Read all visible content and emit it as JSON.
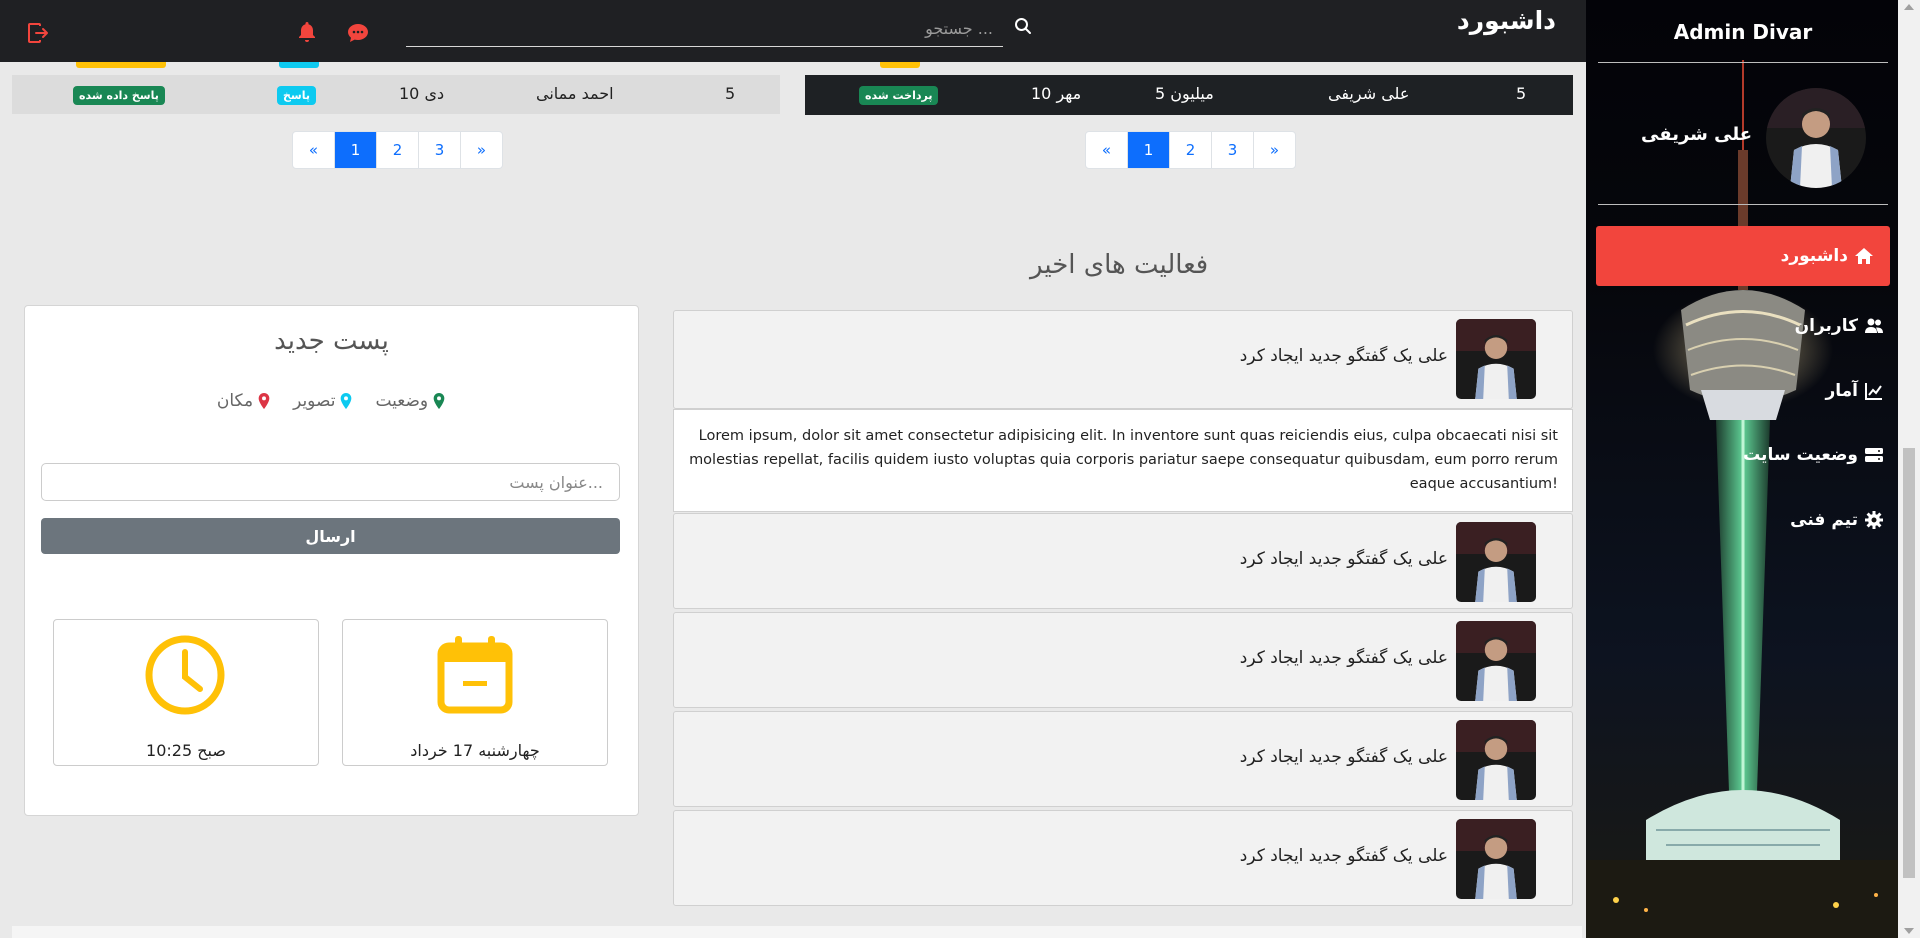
{
  "header": {
    "title": "داشبورد",
    "search_placeholder": "جستجو ..."
  },
  "sidebar": {
    "brand": "Admin Divar",
    "profile_name": "علی شریفی",
    "nav": [
      {
        "label": "داشبورد",
        "icon": "home-icon",
        "active": true
      },
      {
        "label": "کاربران",
        "icon": "users-icon"
      },
      {
        "label": "آمار",
        "icon": "chart-icon"
      },
      {
        "label": "وضعیت سایت",
        "icon": "server-icon"
      },
      {
        "label": "تیم فنی",
        "icon": "gear-icon"
      }
    ]
  },
  "left_table_row": {
    "num": "5",
    "name": "احمد ممانی",
    "date": "10 دی",
    "badge_answer": "پاسخ",
    "badge_status": "پاسخ داده شده"
  },
  "right_table_row": {
    "num": "5",
    "name": "علی شریفی",
    "amount": "5 میلیون",
    "date": "10 مهر",
    "badge_status": "پرداخت شده"
  },
  "pagination": {
    "prev": "«",
    "next": "»",
    "pages": [
      "1",
      "2",
      "3"
    ]
  },
  "activities": {
    "heading": "فعالیت های اخیر",
    "item_text": "علی یک گفتگو جدید ایجاد کرد",
    "lorem": "Lorem ipsum, dolor sit amet consectetur adipisicing elit. In inventore sunt quas reiciendis eius, culpa obcaecati nisi sit molestias repellat, facilis quidem iusto voluptas quia corporis pariatur saepe consequatur quibusdam, eum porro rerum eaque accusantium!"
  },
  "new_post": {
    "title": "پست جدید",
    "opt_status": "وضعیت",
    "opt_image": "تصویر",
    "opt_location": "مکان",
    "input_placeholder": "عنوان پست...",
    "submit": "ارسال",
    "date_label": "چهارشنبه 17 خرداد",
    "time_label": "10:25 صبح"
  },
  "colors": {
    "accent_red": "#f2453d",
    "primary": "#0d6efd",
    "success": "#198754",
    "info": "#0dcaf0",
    "warning": "#ffc107",
    "secondary": "#6c757d",
    "topbar": "#1f2023"
  }
}
